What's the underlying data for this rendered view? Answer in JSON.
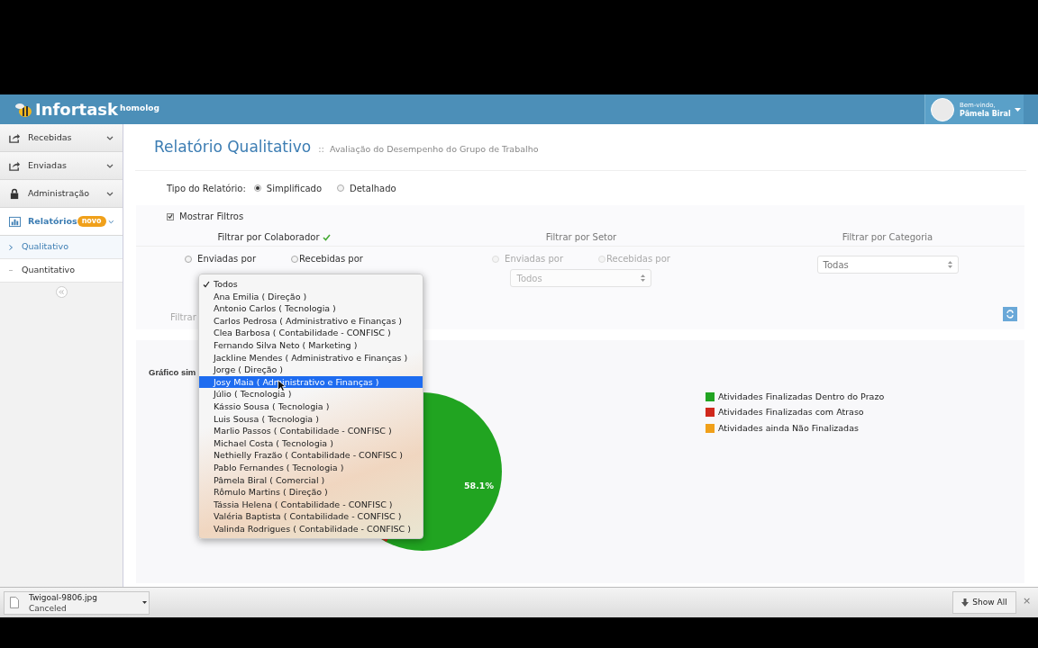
{
  "header": {
    "brand": "Infortask",
    "environment": "homolog",
    "user": {
      "greeting": "Bem-vindo,",
      "name": "Pâmela Biral"
    }
  },
  "sidebar": {
    "items": [
      {
        "label": "Recebidas",
        "kind": "share",
        "selected": false
      },
      {
        "label": "Enviadas",
        "kind": "share",
        "selected": false
      },
      {
        "label": "Administração",
        "kind": "lock",
        "selected": false
      },
      {
        "label": "Relatórios",
        "kind": "chart",
        "selected": true,
        "badge": "novo",
        "children": [
          {
            "label": "Qualitativo",
            "selected": true
          },
          {
            "label": "Quantitativo",
            "selected": false
          }
        ]
      }
    ]
  },
  "page": {
    "title": "Relatório Qualitativo",
    "separator": "::",
    "subtitle": "Avaliação do Desempenho do Grupo de Trabalho"
  },
  "report_type": {
    "label": "Tipo do Relatório:",
    "options": [
      {
        "label": "Simplificado",
        "selected": true
      },
      {
        "label": "Detalhado",
        "selected": false
      }
    ]
  },
  "show_filters": {
    "label": "Mostrar Filtros",
    "checked": true
  },
  "filters": [
    {
      "title": "Filtrar por Colaborador",
      "active": true,
      "disabled": false,
      "radios": [
        {
          "label": "Enviadas por",
          "selected": false
        },
        {
          "label": "Recebidas por",
          "selected": false
        }
      ]
    },
    {
      "title": "Filtrar por Setor",
      "active": false,
      "disabled": true,
      "radios": [
        {
          "label": "Enviadas por",
          "selected": false
        },
        {
          "label": "Recebidas por",
          "selected": false
        }
      ],
      "select": "Todos"
    },
    {
      "title": "Filtrar por Categoria",
      "active": false,
      "disabled": false,
      "select": "Todas"
    }
  ],
  "filter_footer_label": "Filtrar",
  "dropdown": {
    "options": [
      {
        "label": "Todos",
        "checked": true,
        "selected": false
      },
      {
        "label": "Ana Emilia ( Direção )",
        "checked": false,
        "selected": false
      },
      {
        "label": "Antonio Carlos ( Tecnologia )",
        "checked": false,
        "selected": false
      },
      {
        "label": "Carlos Pedrosa ( Administrativo e Finanças )",
        "checked": false,
        "selected": false
      },
      {
        "label": "Clea Barbosa ( Contabilidade - CONFISC )",
        "checked": false,
        "selected": false
      },
      {
        "label": "Fernando Silva Neto ( Marketing )",
        "checked": false,
        "selected": false
      },
      {
        "label": "Jackline Mendes ( Administrativo e Finanças )",
        "checked": false,
        "selected": false
      },
      {
        "label": "Jorge ( Direção )",
        "checked": false,
        "selected": false
      },
      {
        "label": "Josy Maia ( Administrativo e Finanças )",
        "checked": false,
        "selected": true
      },
      {
        "label": "Júlio ( Tecnologia )",
        "checked": false,
        "selected": false
      },
      {
        "label": "Kássio Sousa ( Tecnologia )",
        "checked": false,
        "selected": false
      },
      {
        "label": "Luis Sousa ( Tecnologia )",
        "checked": false,
        "selected": false
      },
      {
        "label": "Marlio Passos ( Contabilidade - CONFISC )",
        "checked": false,
        "selected": false
      },
      {
        "label": "Michael Costa ( Tecnologia )",
        "checked": false,
        "selected": false
      },
      {
        "label": "Nethielly Frazão ( Contabilidade - CONFISC )",
        "checked": false,
        "selected": false
      },
      {
        "label": "Pablo Fernandes ( Tecnologia )",
        "checked": false,
        "selected": false
      },
      {
        "label": "Pâmela Biral ( Comercial )",
        "checked": false,
        "selected": false
      },
      {
        "label": "Rômulo Martins ( Direção )",
        "checked": false,
        "selected": false
      },
      {
        "label": "Tássia Helena ( Contabilidade - CONFISC )",
        "checked": false,
        "selected": false
      },
      {
        "label": "Valéria Baptista ( Contabilidade - CONFISC )",
        "checked": false,
        "selected": false
      },
      {
        "label": "Valinda Rodrigues ( Contabilidade - CONFISC )",
        "checked": false,
        "selected": false
      }
    ]
  },
  "chart_panel": {
    "title": "Gráfico sim",
    "slice_label": "58.1%",
    "legend": [
      {
        "label": "Atividades Finalizadas Dentro do Prazo",
        "color": "#21a421"
      },
      {
        "label": "Atividades Finalizadas com Atraso",
        "color": "#d0281c"
      },
      {
        "label": "Atividades ainda Não Finalizadas",
        "color": "#f0a01a"
      }
    ]
  },
  "download_bar": {
    "file": "Twigoal-9806.jpg",
    "status": "Canceled",
    "show_all": "Show All",
    "close": "×"
  }
}
